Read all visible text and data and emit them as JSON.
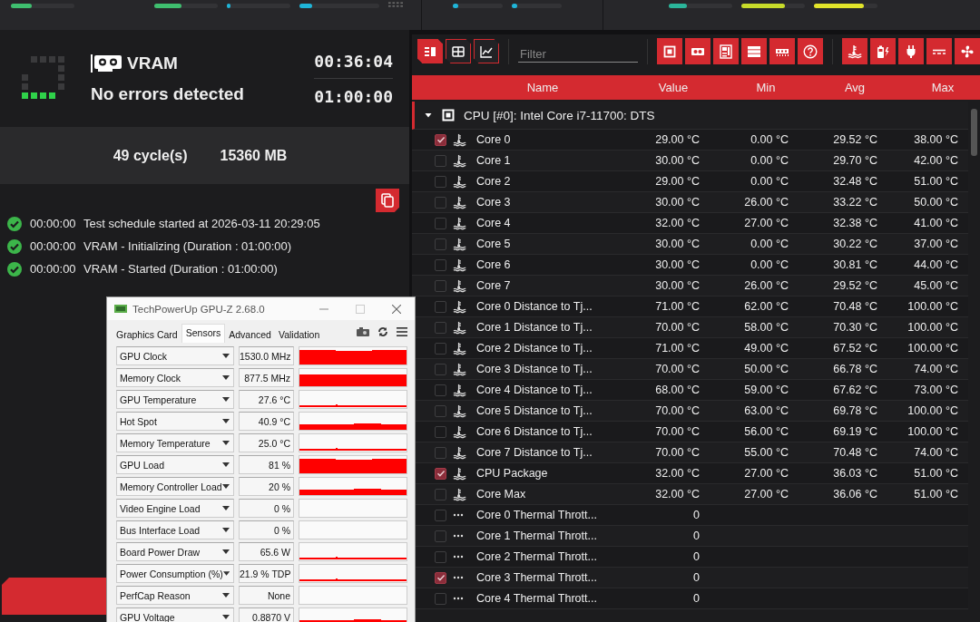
{
  "status_strip": [
    {
      "meters": [
        {
          "level": 0.33,
          "color": "#3fbf6f"
        },
        {
          "level": 0.43,
          "color": "#3fbf6f"
        },
        {
          "level": 0.06,
          "color": "#1fb5d8"
        },
        {
          "level": 0.16,
          "color": "#1fb5d8"
        }
      ]
    },
    {
      "meters": [
        {
          "level": 0.1,
          "color": "#1fb5d8"
        },
        {
          "level": 0.1,
          "color": "#1fb5d8"
        }
      ]
    },
    {
      "meters": [
        {
          "level": 0.28,
          "color": "#2bb59a"
        },
        {
          "level": 0.68,
          "color": "#c8dc2a"
        },
        {
          "level": 0.78,
          "color": "#e2e42a"
        }
      ]
    }
  ],
  "test": {
    "name": "VRAM",
    "status": "No errors detected",
    "elapsed": "00:36:04",
    "duration": "01:00:00",
    "cycles": "49 cycle(s)",
    "size": "15360 MB"
  },
  "log": [
    {
      "time": "00:00:00",
      "text": "Test schedule started at 2026-03-11 20:29:05"
    },
    {
      "time": "00:00:00",
      "text": "VRAM - Initializing (Duration : 01:00:00)"
    },
    {
      "time": "00:00:00",
      "text": "VRAM - Started (Duration : 01:00:00)"
    }
  ],
  "toolbar": {
    "view_buttons": [
      {
        "kind": "list",
        "on": true
      },
      {
        "kind": "table",
        "on": false
      },
      {
        "kind": "chart",
        "on": false
      }
    ],
    "filter": {
      "placeholder": "Filter"
    },
    "category_buttons": [
      {
        "kind": "cpu"
      },
      {
        "kind": "gpu"
      },
      {
        "kind": "motherboard"
      },
      {
        "kind": "storage"
      },
      {
        "kind": "memory"
      },
      {
        "kind": "help"
      }
    ],
    "sensor_buttons": [
      {
        "kind": "temperature"
      },
      {
        "kind": "battery"
      },
      {
        "kind": "plug"
      },
      {
        "kind": "dc"
      },
      {
        "kind": "fan"
      }
    ]
  },
  "table": {
    "columns": [
      "Name",
      "Value",
      "Min",
      "Avg",
      "Max"
    ],
    "group": {
      "label": "CPU [#0]: Intel Core i7-11700: DTS",
      "expanded": true
    },
    "rows": [
      {
        "kind": "temperature",
        "checked": true,
        "name": "Core 0",
        "value": "29.00 °C",
        "min": "0.00 °C",
        "avg": "29.52 °C",
        "max": "38.00 °C"
      },
      {
        "kind": "temperature",
        "checked": false,
        "name": "Core 1",
        "value": "30.00 °C",
        "min": "0.00 °C",
        "avg": "29.70 °C",
        "max": "42.00 °C"
      },
      {
        "kind": "temperature",
        "checked": false,
        "name": "Core 2",
        "value": "29.00 °C",
        "min": "0.00 °C",
        "avg": "32.48 °C",
        "max": "51.00 °C"
      },
      {
        "kind": "temperature",
        "checked": false,
        "name": "Core 3",
        "value": "30.00 °C",
        "min": "26.00 °C",
        "avg": "33.22 °C",
        "max": "50.00 °C"
      },
      {
        "kind": "temperature",
        "checked": false,
        "name": "Core 4",
        "value": "32.00 °C",
        "min": "27.00 °C",
        "avg": "32.38 °C",
        "max": "41.00 °C"
      },
      {
        "kind": "temperature",
        "checked": false,
        "name": "Core 5",
        "value": "30.00 °C",
        "min": "0.00 °C",
        "avg": "30.22 °C",
        "max": "37.00 °C"
      },
      {
        "kind": "temperature",
        "checked": false,
        "name": "Core 6",
        "value": "30.00 °C",
        "min": "0.00 °C",
        "avg": "30.81 °C",
        "max": "44.00 °C"
      },
      {
        "kind": "temperature",
        "checked": false,
        "name": "Core 7",
        "value": "30.00 °C",
        "min": "26.00 °C",
        "avg": "29.52 °C",
        "max": "45.00 °C"
      },
      {
        "kind": "temperature",
        "checked": false,
        "name": "Core 0 Distance to Tj...",
        "value": "71.00 °C",
        "min": "62.00 °C",
        "avg": "70.48 °C",
        "max": "100.00 °C"
      },
      {
        "kind": "temperature",
        "checked": false,
        "name": "Core 1 Distance to Tj...",
        "value": "70.00 °C",
        "min": "58.00 °C",
        "avg": "70.30 °C",
        "max": "100.00 °C"
      },
      {
        "kind": "temperature",
        "checked": false,
        "name": "Core 2 Distance to Tj...",
        "value": "71.00 °C",
        "min": "49.00 °C",
        "avg": "67.52 °C",
        "max": "100.00 °C"
      },
      {
        "kind": "temperature",
        "checked": false,
        "name": "Core 3 Distance to Tj...",
        "value": "70.00 °C",
        "min": "50.00 °C",
        "avg": "66.78 °C",
        "max": "74.00 °C"
      },
      {
        "kind": "temperature",
        "checked": false,
        "name": "Core 4 Distance to Tj...",
        "value": "68.00 °C",
        "min": "59.00 °C",
        "avg": "67.62 °C",
        "max": "73.00 °C"
      },
      {
        "kind": "temperature",
        "checked": false,
        "name": "Core 5 Distance to Tj...",
        "value": "70.00 °C",
        "min": "63.00 °C",
        "avg": "69.78 °C",
        "max": "100.00 °C"
      },
      {
        "kind": "temperature",
        "checked": false,
        "name": "Core 6 Distance to Tj...",
        "value": "70.00 °C",
        "min": "56.00 °C",
        "avg": "69.19 °C",
        "max": "100.00 °C"
      },
      {
        "kind": "temperature",
        "checked": false,
        "name": "Core 7 Distance to Tj...",
        "value": "70.00 °C",
        "min": "55.00 °C",
        "avg": "70.48 °C",
        "max": "74.00 °C"
      },
      {
        "kind": "temperature",
        "checked": true,
        "name": "CPU Package",
        "value": "32.00 °C",
        "min": "27.00 °C",
        "avg": "36.03 °C",
        "max": "51.00 °C"
      },
      {
        "kind": "temperature",
        "checked": false,
        "name": "Core Max",
        "value": "32.00 °C",
        "min": "27.00 °C",
        "avg": "36.06 °C",
        "max": "51.00 °C"
      },
      {
        "kind": "other",
        "checked": false,
        "name": "Core 0 Thermal Thrott...",
        "value": "0"
      },
      {
        "kind": "other",
        "checked": false,
        "name": "Core 1 Thermal Thrott...",
        "value": "0"
      },
      {
        "kind": "other",
        "checked": false,
        "name": "Core 2 Thermal Thrott...",
        "value": "0"
      },
      {
        "kind": "other",
        "checked": true,
        "name": "Core 3 Thermal Thrott...",
        "value": "0"
      },
      {
        "kind": "other",
        "checked": false,
        "name": "Core 4 Thermal Thrott...",
        "value": "0"
      }
    ]
  },
  "gpuz": {
    "title": "TechPowerUp GPU-Z 2.68.0",
    "tabs": [
      {
        "label": "Graphics Card",
        "selected": false
      },
      {
        "label": "Sensors",
        "selected": true
      },
      {
        "label": "Advanced",
        "selected": false
      },
      {
        "label": "Validation",
        "selected": false
      }
    ],
    "sensors": [
      {
        "label": "GPU Clock",
        "value": "1530.0 MHz",
        "kind": "high"
      },
      {
        "label": "Memory Clock",
        "value": "877.5 MHz",
        "kind": "mid"
      },
      {
        "label": "GPU Temperature",
        "value": "27.6 °C",
        "kind": "line"
      },
      {
        "label": "Hot Spot",
        "value": "40.9 °C",
        "kind": "band"
      },
      {
        "label": "Memory Temperature",
        "value": "25.0 °C",
        "kind": "line"
      },
      {
        "label": "GPU Load",
        "value": "81 %",
        "kind": "high"
      },
      {
        "label": "Memory Controller Load",
        "value": "20 %",
        "kind": "band"
      },
      {
        "label": "Video Engine Load",
        "value": "0 %",
        "kind": "flat"
      },
      {
        "label": "Bus Interface Load",
        "value": "0 %",
        "kind": "flat"
      },
      {
        "label": "Board Power Draw",
        "value": "65.6 W",
        "kind": "line"
      },
      {
        "label": "Power Consumption (%)",
        "value": "21.9 % TDP",
        "kind": "line"
      },
      {
        "label": "PerfCap Reason",
        "value": "None",
        "kind": "flat"
      },
      {
        "label": "GPU Voltage",
        "value": "0.8870 V",
        "kind": "band"
      }
    ]
  }
}
